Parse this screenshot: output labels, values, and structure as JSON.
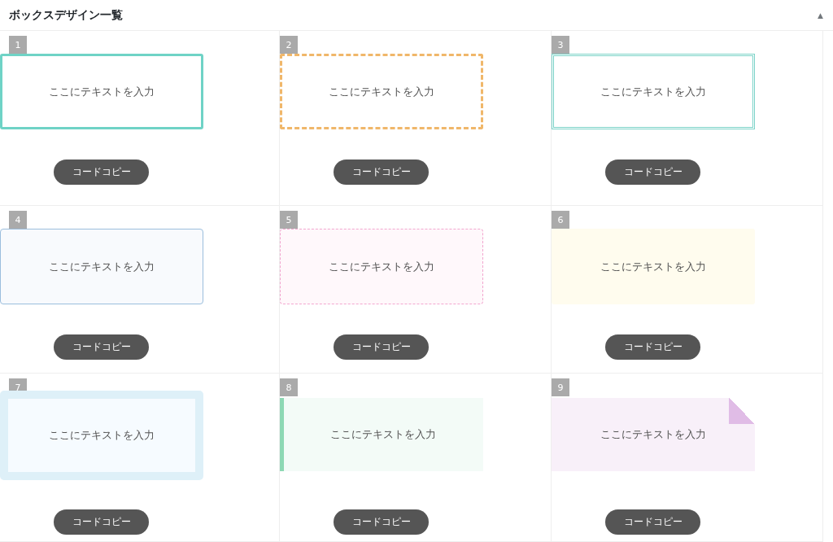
{
  "panel": {
    "title": "ボックスデザイン一覧",
    "collapse_toggle": "▲"
  },
  "items": [
    {
      "number": "1",
      "kind": "solid",
      "text": "ここにテキストを入力",
      "button": "コードコピー"
    },
    {
      "number": "2",
      "kind": "dashed",
      "text": "ここにテキストを入力",
      "button": "コードコピー"
    },
    {
      "number": "3",
      "kind": "double",
      "text": "ここにテキストを入力",
      "button": "コードコピー"
    },
    {
      "number": "4",
      "kind": "thin",
      "text": "ここにテキストを入力",
      "button": "コードコピー"
    },
    {
      "number": "5",
      "kind": "dotted",
      "text": "ここにテキストを入力",
      "button": "コードコピー"
    },
    {
      "number": "6",
      "kind": "fill",
      "text": "ここにテキストを入力",
      "button": "コードコピー"
    },
    {
      "number": "7",
      "kind": "frame",
      "text": "ここにテキストを入力",
      "button": "コードコピー"
    },
    {
      "number": "8",
      "kind": "left-bar",
      "text": "ここにテキストを入力",
      "button": "コードコピー"
    },
    {
      "number": "9",
      "kind": "folded",
      "text": "ここにテキストを入力",
      "button": "コードコピー"
    }
  ]
}
